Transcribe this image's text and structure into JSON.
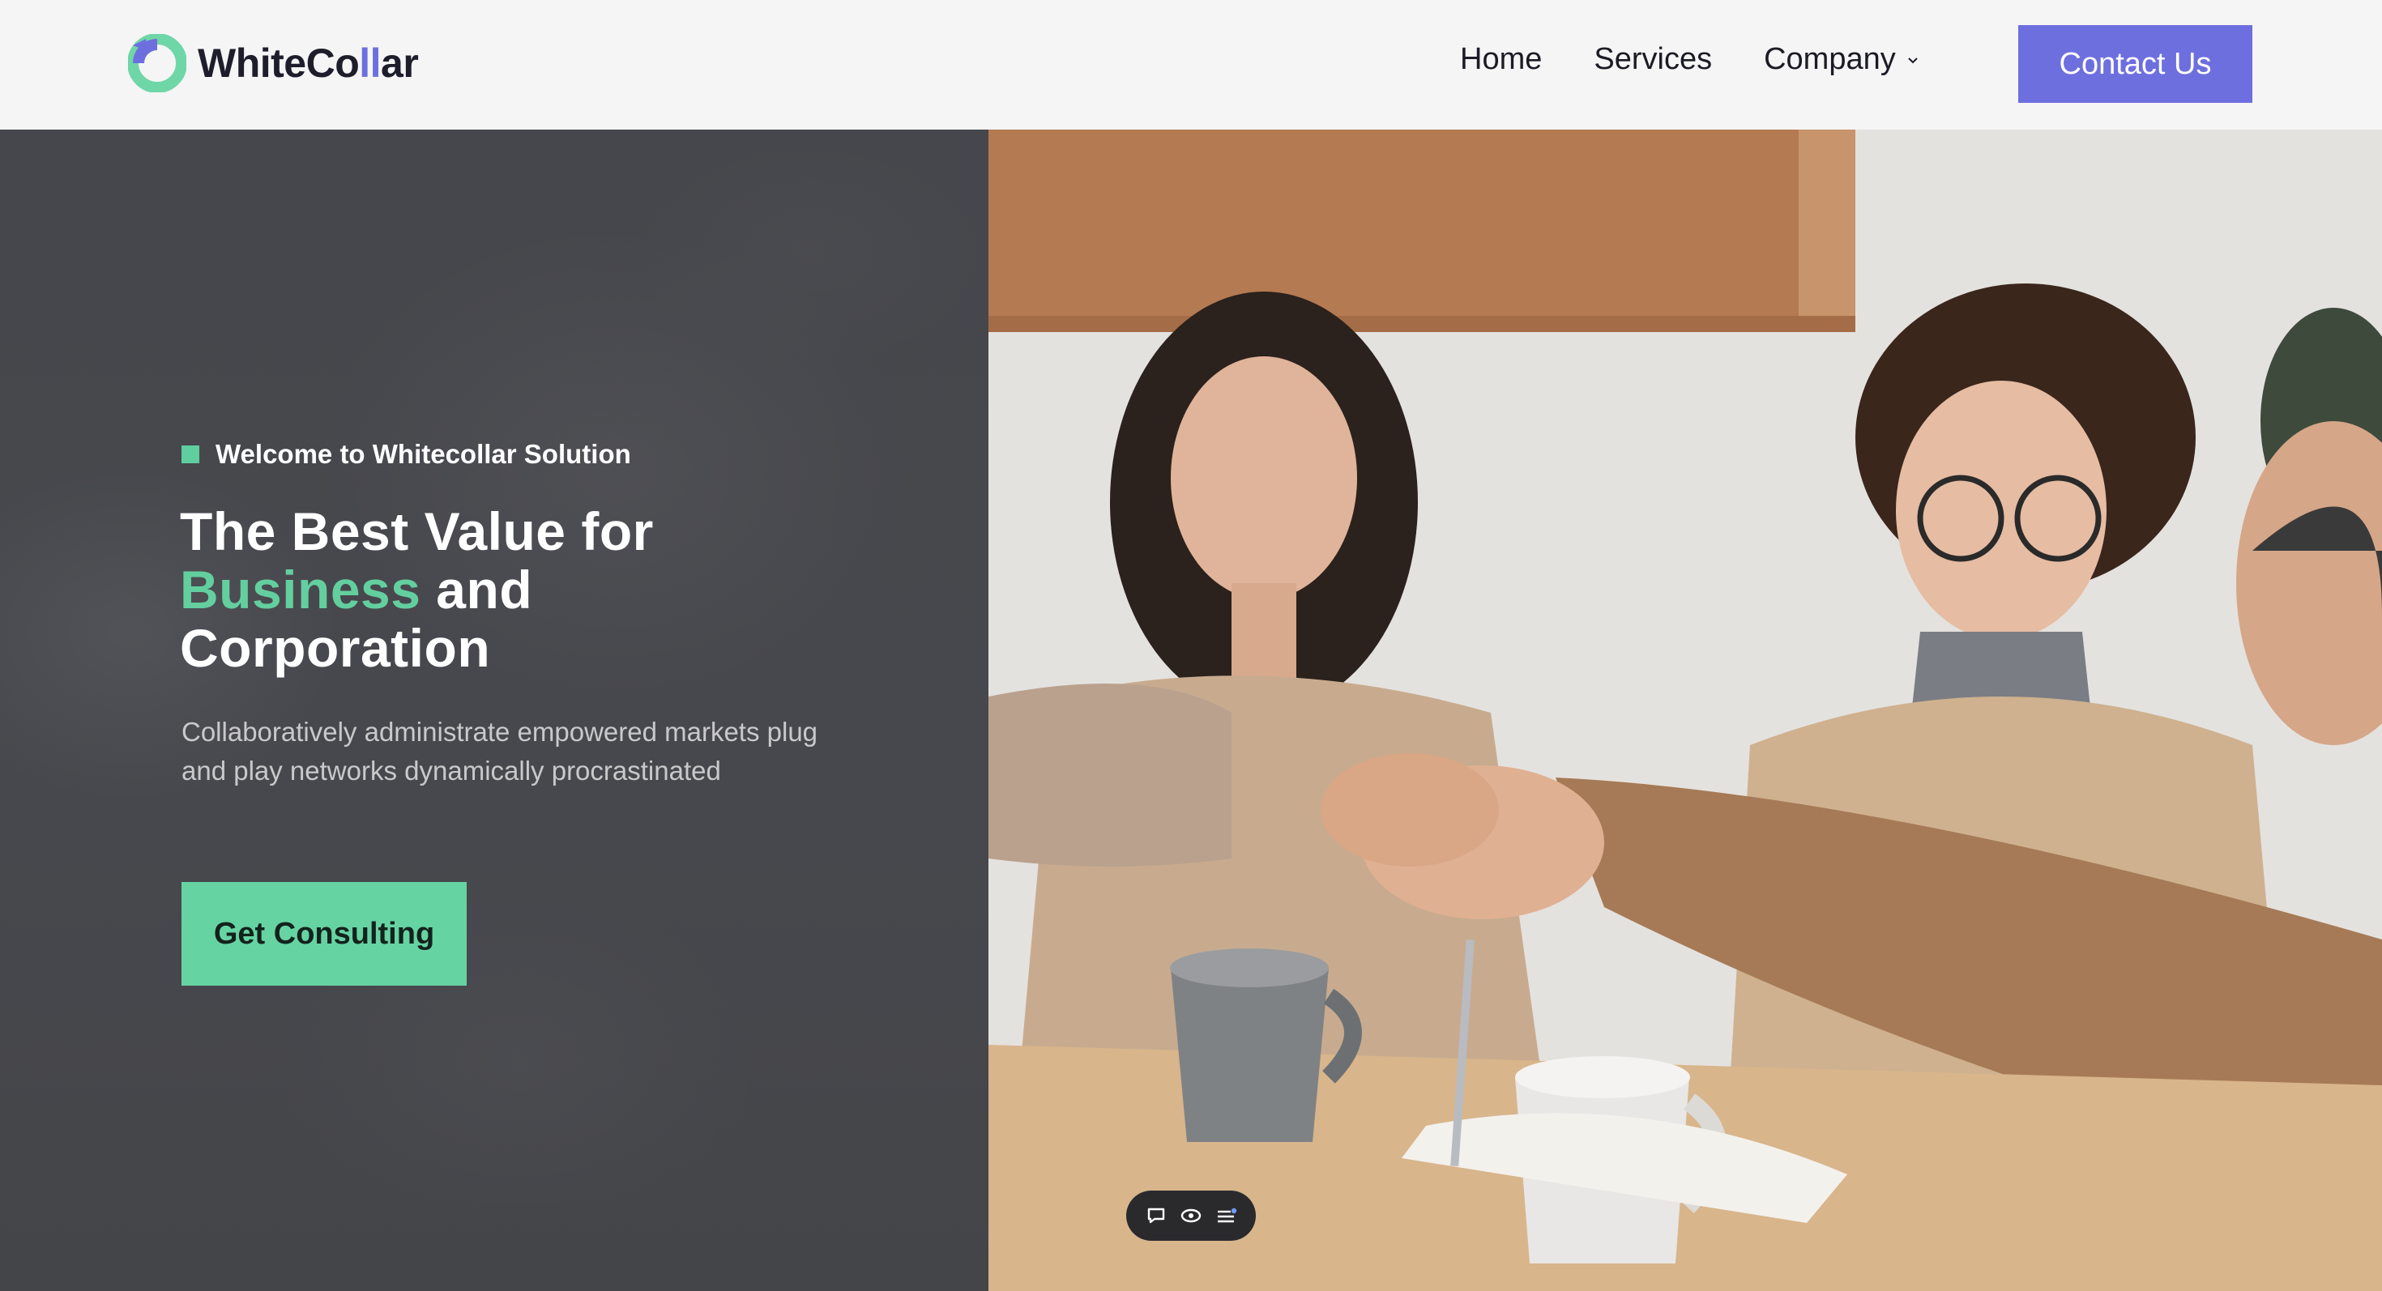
{
  "brand": {
    "name_prefix": "WhiteCo",
    "name_accent": "ll",
    "name_suffix": "ar",
    "colors": {
      "primary": "#6d6fdf",
      "accent": "#63cf9f",
      "dark": "#1d1d2b"
    }
  },
  "nav": {
    "items": [
      {
        "label": "Home"
      },
      {
        "label": "Services"
      },
      {
        "label": "Company",
        "has_dropdown": true
      }
    ],
    "contact_label": "Contact Us"
  },
  "hero": {
    "eyebrow": "Welcome to Whitecollar Solution",
    "headline_line1": "The Best Value for",
    "headline_green": "Business",
    "headline_after_green": " and",
    "headline_line3": "Corporation",
    "description": "Collaboratively administrate empowered markets plug and play networks dynamically procrastinated",
    "cta_label": "Get Consulting"
  },
  "floating_toolbar": {
    "icons": [
      "chat-bubble-icon",
      "eye-icon",
      "menu-list-icon"
    ]
  }
}
